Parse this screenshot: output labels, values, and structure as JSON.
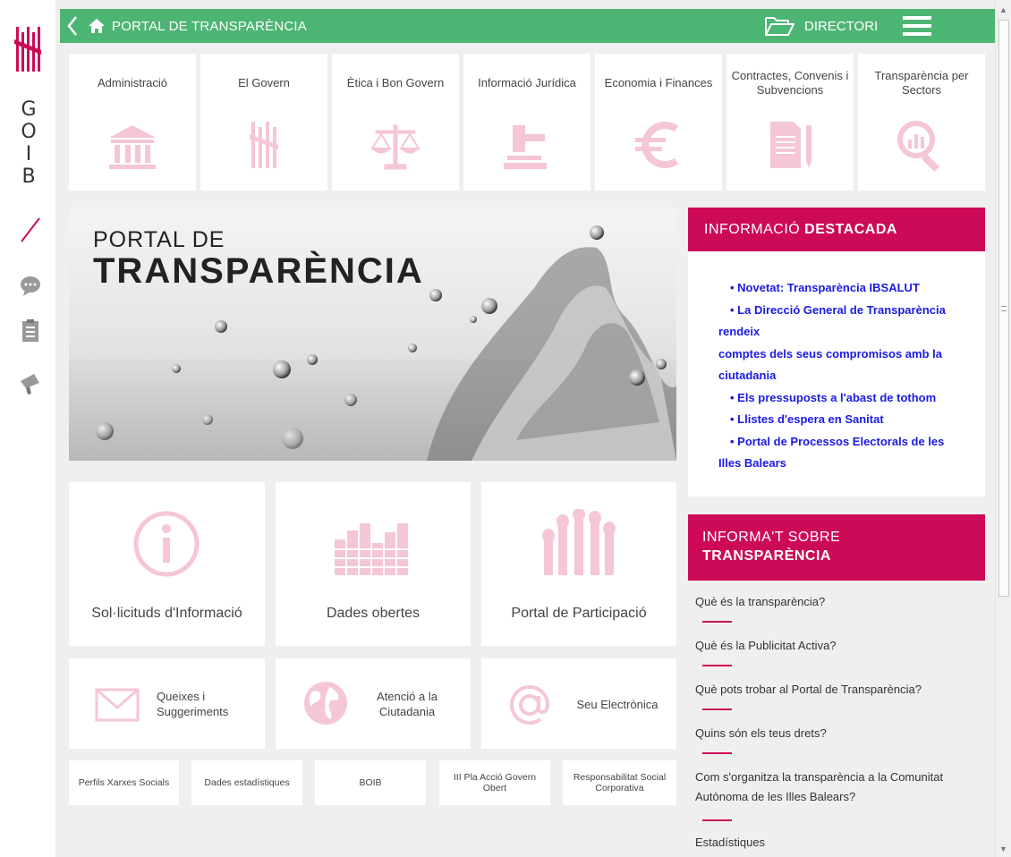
{
  "brand": {
    "name_letters": [
      "G",
      "O",
      "I",
      "B"
    ],
    "accent_red": "#cc0a57",
    "topbar_green": "#4db574"
  },
  "rail": {
    "icons": [
      "chat-icon",
      "clipboard-icon",
      "megaphone-icon"
    ]
  },
  "topbar": {
    "title": "PORTAL DE TRANSPARÈNCIA",
    "directori_label": "DIRECTORI"
  },
  "categories": [
    {
      "label": "Administració",
      "icon": "building-icon"
    },
    {
      "label": "El Govern",
      "icon": "govern-emblem-icon"
    },
    {
      "label": "Ètica i Bon Govern",
      "icon": "scales-icon"
    },
    {
      "label": "Informació Jurídica",
      "icon": "gavel-icon"
    },
    {
      "label": "Economia i Finances",
      "icon": "euro-icon"
    },
    {
      "label": "Contractes, Convenis i Subvencions",
      "icon": "document-pen-icon"
    },
    {
      "label": "Transparència per Sectors",
      "icon": "magnifier-chart-icon"
    }
  ],
  "hero": {
    "line1": "PORTAL DE",
    "line2": "TRANSPARÈNCIA"
  },
  "destacada": {
    "heading_normal": "INFORMACIÓ ",
    "heading_bold": "DESTACADA",
    "items": [
      {
        "text": "Novetat: Transparència IBSALUT",
        "bullet": true
      },
      {
        "text": "La Direcció General de Transparència",
        "bullet": true
      },
      {
        "text": "rendeix",
        "bullet": false
      },
      {
        "text": "comptes dels seus compromisos amb la",
        "bullet": false
      },
      {
        "text": "ciutadania",
        "bullet": false
      },
      {
        "text": "Els pressuposts a l'abast de tothom",
        "bullet": true
      },
      {
        "text": "Llistes d'espera en Sanitat",
        "bullet": true
      },
      {
        "text": "Portal de Processos Electorals de les",
        "bullet": true
      },
      {
        "text": "Illes Balears",
        "bullet": false
      }
    ]
  },
  "informa": {
    "heading_line1": "INFORMA'T SOBRE",
    "heading_line2": "TRANSPARÈNCIA",
    "questions": [
      "Què és la transparència?",
      "Què és la Publicitat Activa?",
      "Què pots trobar al Portal de Transparència?",
      "Quins són els teus drets?",
      "Com s'organitza la transparència a la Comunitat Autònoma de les Illes Balears?",
      "Estadístiques"
    ]
  },
  "features": [
    {
      "label": "Sol·licituds d'Informació",
      "icon": "info-icon"
    },
    {
      "label": "Dades obertes",
      "icon": "bar-chart-icon"
    },
    {
      "label": "Portal de Participació",
      "icon": "raised-hands-icon"
    }
  ],
  "services": [
    {
      "label": "Queixes i Suggeriments",
      "icon": "envelope-icon"
    },
    {
      "label": "Atenció a la Ciutadania",
      "icon": "globe-icon"
    },
    {
      "label": "Seu Electrònica",
      "icon": "at-sign-icon"
    }
  ],
  "links": [
    "Perfils Xarxes Socials",
    "Dades estadístiques",
    "BOIB",
    "III Pla Acció Govern Obert",
    "Responsabilitat Social Corporativa"
  ]
}
